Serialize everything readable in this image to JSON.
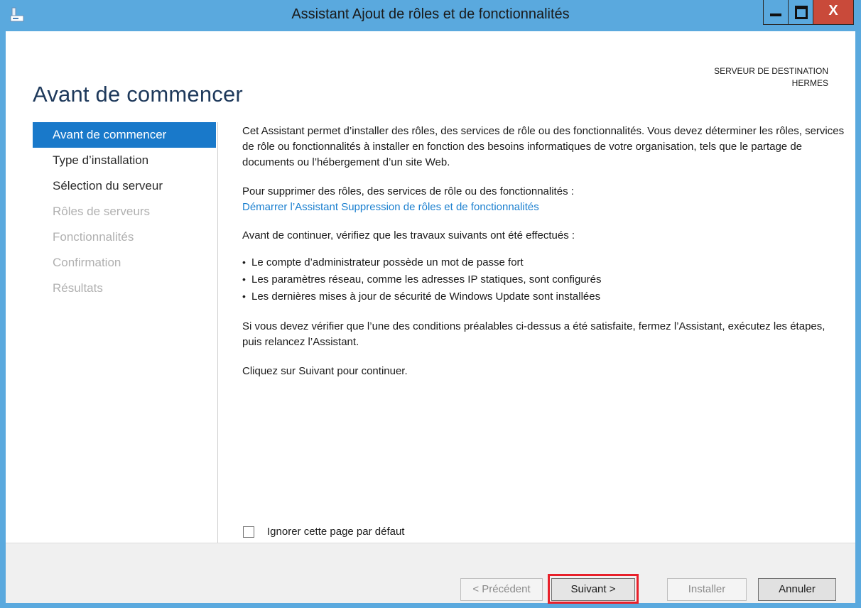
{
  "window": {
    "title": "Assistant Ajout de rôles et de fonctionnalités",
    "close_glyph": "X"
  },
  "header": {
    "page_title": "Avant de commencer",
    "destination_label": "SERVEUR DE DESTINATION",
    "destination_server": "HERMES"
  },
  "nav": {
    "items": [
      {
        "label": "Avant de commencer",
        "state": "active"
      },
      {
        "label": "Type d’installation",
        "state": "enabled"
      },
      {
        "label": "Sélection du serveur",
        "state": "enabled"
      },
      {
        "label": "Rôles de serveurs",
        "state": "disabled"
      },
      {
        "label": "Fonctionnalités",
        "state": "disabled"
      },
      {
        "label": "Confirmation",
        "state": "disabled"
      },
      {
        "label": "Résultats",
        "state": "disabled"
      }
    ]
  },
  "content": {
    "intro": "Cet Assistant permet d’installer des rôles, des services de rôle ou des fonctionnalités. Vous devez déterminer les rôles, services de rôle ou fonctionnalités à installer en fonction des besoins informatiques de votre organisation, tels que le partage de documents ou l’hébergement d’un site Web.",
    "remove_text": "Pour supprimer des rôles, des services de rôle ou des fonctionnalités :",
    "remove_link": "Démarrer l’Assistant Suppression de rôles et de fonctionnalités",
    "check_intro": "Avant de continuer, vérifiez que les travaux suivants ont été effectués :",
    "bullets": [
      "Le compte d’administrateur possède un mot de passe fort",
      "Les paramètres réseau, comme les adresses IP statiques, sont configurés",
      "Les dernières mises à jour de sécurité de Windows Update sont installées"
    ],
    "prereq_text": "Si vous devez vérifier que l’une des conditions préalables ci-dessus a été satisfaite, fermez l’Assistant, exécutez les étapes, puis relancez l’Assistant.",
    "next_hint": "Cliquez sur Suivant pour continuer."
  },
  "skip": {
    "label": "Ignorer cette page par défaut",
    "checked": false
  },
  "footer": {
    "prev_label": "< Précédent",
    "next_label": "Suivant >",
    "install_label": "Installer",
    "cancel_label": "Annuler"
  },
  "colors": {
    "titlebar": "#5aa9de",
    "active_nav": "#1979ca",
    "link": "#1a7fcf",
    "highlight": "#e8202a",
    "close_button": "#c94a3a"
  }
}
